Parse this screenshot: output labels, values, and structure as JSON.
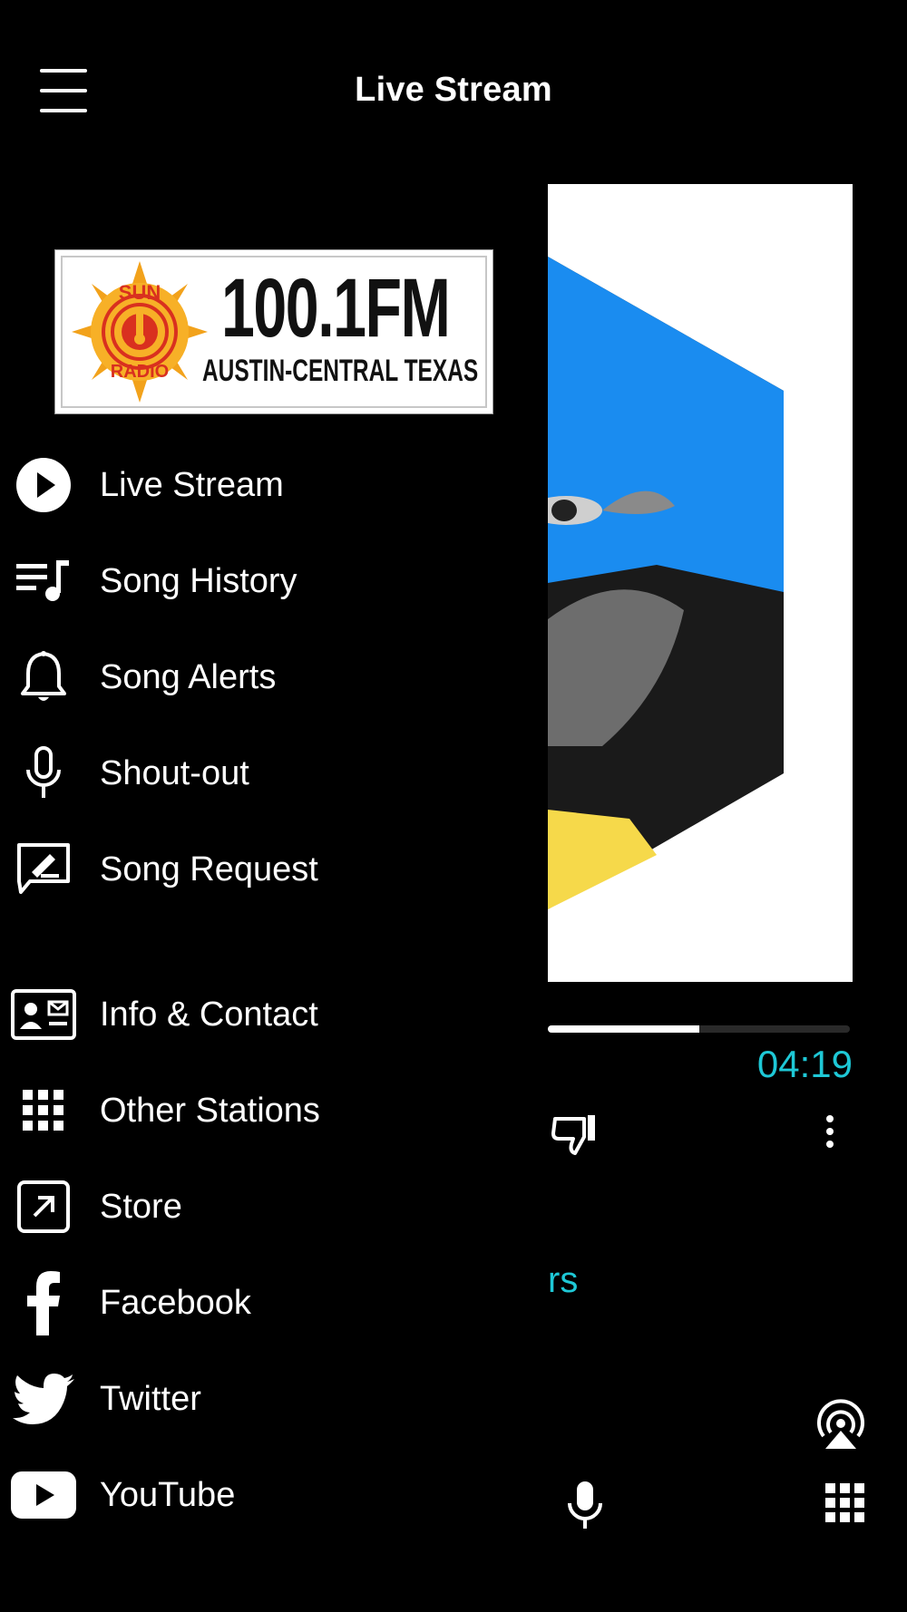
{
  "header": {
    "title": "Live Stream",
    "menu_icon": "hamburger-menu-icon"
  },
  "logo": {
    "station_name": "SUN RADIO",
    "frequency": "100.1FM",
    "region": "AUSTIN-CENTRAL TEXAS"
  },
  "drawer": {
    "primary_items": [
      {
        "label": "Live Stream",
        "icon": "play-circle-icon"
      },
      {
        "label": "Song History",
        "icon": "playlist-icon"
      },
      {
        "label": "Song Alerts",
        "icon": "bell-icon"
      },
      {
        "label": "Shout-out",
        "icon": "microphone-icon"
      },
      {
        "label": "Song Request",
        "icon": "request-message-icon"
      }
    ],
    "secondary_items": [
      {
        "label": "Info & Contact",
        "icon": "contact-card-icon"
      },
      {
        "label": "Other Stations",
        "icon": "grid-icon"
      },
      {
        "label": "Store",
        "icon": "external-link-icon"
      },
      {
        "label": "Facebook",
        "icon": "facebook-icon"
      },
      {
        "label": "Twitter",
        "icon": "twitter-icon"
      },
      {
        "label": "YouTube",
        "icon": "youtube-icon"
      }
    ]
  },
  "player": {
    "progress_fraction": 0.5,
    "time": "04:19",
    "artist_fragment": "rs",
    "accent_color": "#1ec8d6",
    "icons": [
      "thumbs-down-icon",
      "more-vertical-icon",
      "airplay-icon",
      "microphone-icon",
      "grid-icon"
    ]
  }
}
